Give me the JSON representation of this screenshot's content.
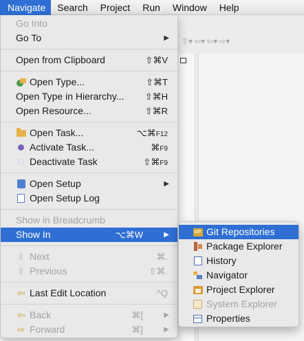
{
  "menubar": {
    "items": [
      "Navigate",
      "Search",
      "Project",
      "Run",
      "Window",
      "Help"
    ],
    "active": "Navigate"
  },
  "navigate_menu": {
    "go_into": "Go Into",
    "go_to": "Go To",
    "open_from_clipboard": {
      "label": "Open from Clipboard",
      "shortcut": "⇧⌘V"
    },
    "open_type": {
      "label": "Open Type...",
      "shortcut": "⇧⌘T"
    },
    "open_type_hierarchy": {
      "label": "Open Type in Hierarchy...",
      "shortcut": "⇧⌘H"
    },
    "open_resource": {
      "label": "Open Resource...",
      "shortcut": "⇧⌘R"
    },
    "open_task": {
      "label": "Open Task...",
      "shortcut": "⌥⌘",
      "shortcut_key": "F12"
    },
    "activate_task": {
      "label": "Activate Task...",
      "shortcut": "⌘",
      "shortcut_key": "F9"
    },
    "deactivate_task": {
      "label": "Deactivate Task",
      "shortcut": "⇧⌘",
      "shortcut_key": "F9"
    },
    "open_setup": "Open Setup",
    "open_setup_log": "Open Setup Log",
    "show_in_breadcrumb": "Show in Breadcrumb",
    "show_in": {
      "label": "Show In",
      "shortcut": "⌥⌘W"
    },
    "next": {
      "label": "Next",
      "shortcut": "⌘."
    },
    "previous": {
      "label": "Previous",
      "shortcut": "⇧⌘."
    },
    "last_edit_location": {
      "label": "Last Edit Location",
      "shortcut": "^Q"
    },
    "back": {
      "label": "Back",
      "shortcut": "⌘["
    },
    "forward": {
      "label": "Forward",
      "shortcut": "⌘]"
    }
  },
  "show_in_submenu": {
    "items": [
      {
        "label": "Git Repositories",
        "icon": "git-repositories-icon",
        "selected": true,
        "disabled": false
      },
      {
        "label": "Package Explorer",
        "icon": "package-explorer-icon",
        "selected": false,
        "disabled": false
      },
      {
        "label": "History",
        "icon": "history-icon",
        "selected": false,
        "disabled": false
      },
      {
        "label": "Navigator",
        "icon": "navigator-icon",
        "selected": false,
        "disabled": false
      },
      {
        "label": "Project Explorer",
        "icon": "project-explorer-icon",
        "selected": false,
        "disabled": false
      },
      {
        "label": "System Explorer",
        "icon": "system-explorer-icon",
        "selected": false,
        "disabled": true
      },
      {
        "label": "Properties",
        "icon": "properties-icon",
        "selected": false,
        "disabled": false
      }
    ]
  },
  "colors": {
    "selection": "#2f6fd4",
    "menu_background": "#e9e9e9",
    "disabled_text": "#a3a3a3"
  }
}
